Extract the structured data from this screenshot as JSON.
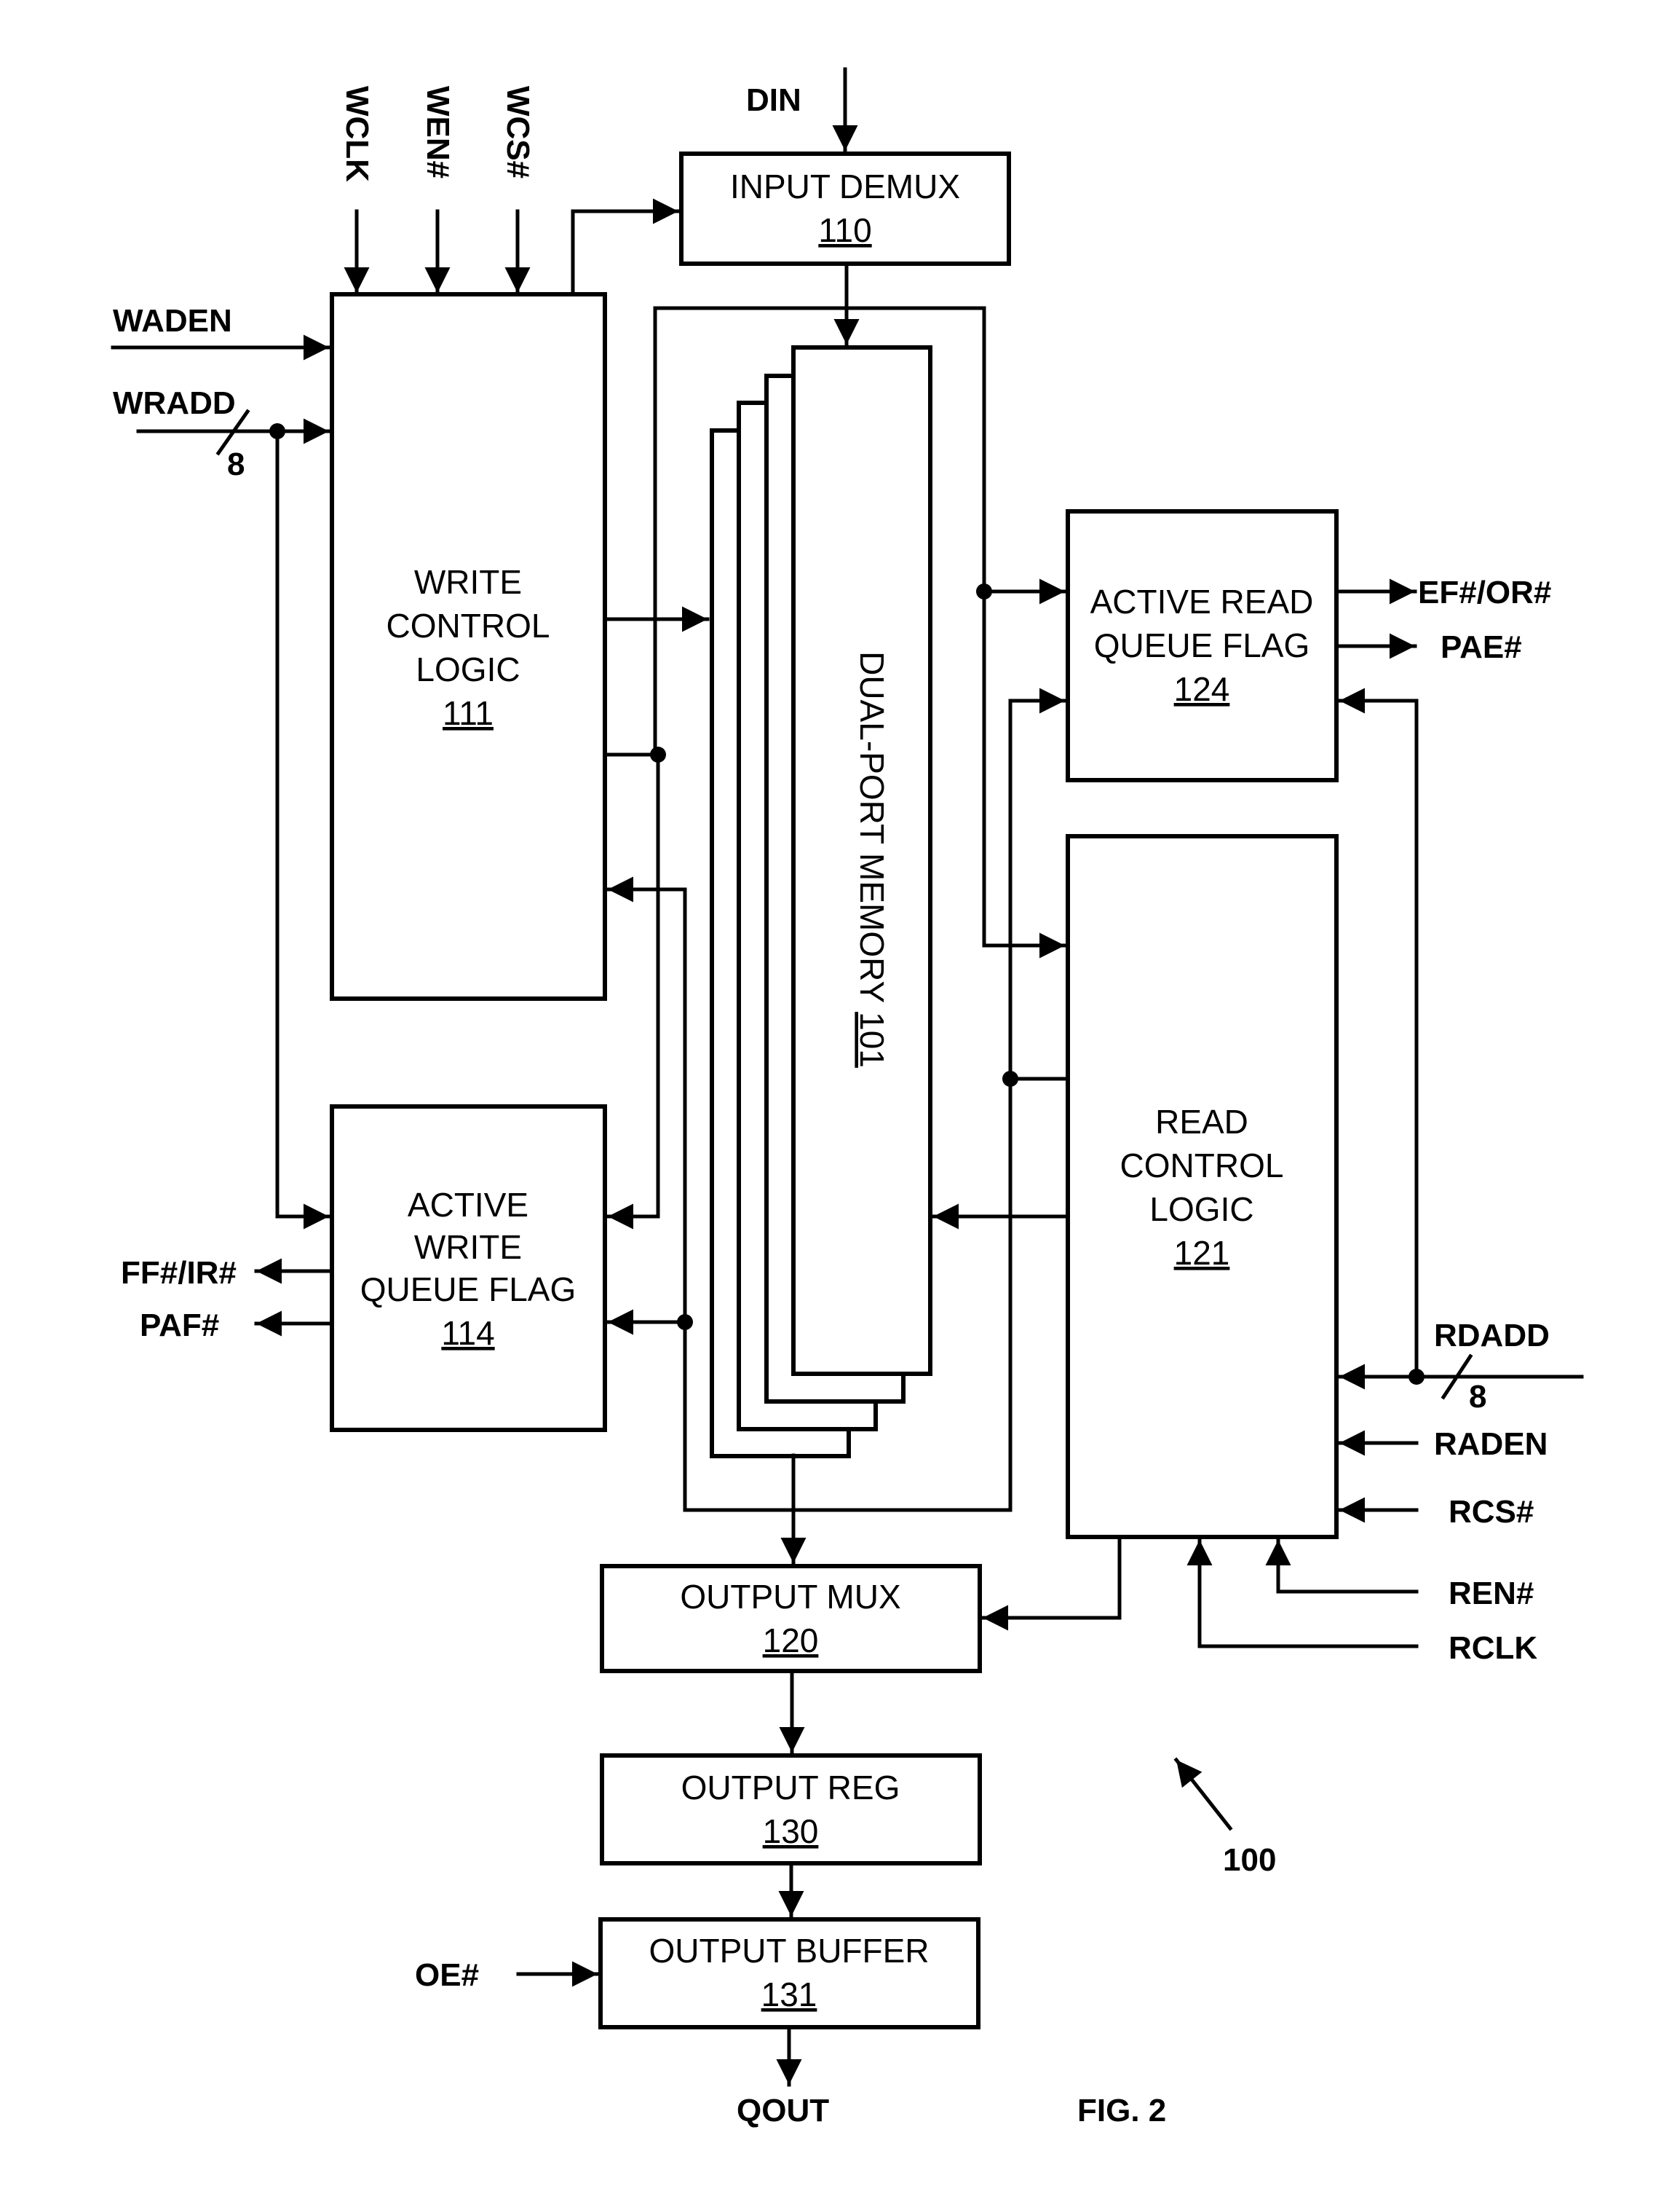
{
  "figure": {
    "label": "FIG. 2",
    "reference": "100"
  },
  "blocks": {
    "input_demux": {
      "name": "INPUT DEMUX",
      "ref": "110"
    },
    "write_control": {
      "lines": [
        "WRITE",
        "CONTROL",
        "LOGIC"
      ],
      "ref": "111"
    },
    "write_flag": {
      "lines": [
        "ACTIVE",
        "WRITE",
        "QUEUE FLAG"
      ],
      "ref": "114"
    },
    "memory": {
      "name": "DUAL-PORT MEMORY",
      "ref": "101"
    },
    "read_flag": {
      "lines": [
        "ACTIVE READ",
        "QUEUE FLAG"
      ],
      "ref": "124"
    },
    "read_control": {
      "lines": [
        "READ",
        "CONTROL",
        "LOGIC"
      ],
      "ref": "121"
    },
    "output_mux": {
      "name": "OUTPUT MUX",
      "ref": "120"
    },
    "output_reg": {
      "name": "OUTPUT REG",
      "ref": "130"
    },
    "output_buffer": {
      "name": "OUTPUT BUFFER",
      "ref": "131"
    }
  },
  "signals": {
    "din": "DIN",
    "wclk": "WCLK",
    "wen": "WEN#",
    "wcs": "WCS#",
    "waden": "WADEN",
    "wradd": "WRADD",
    "wradd_width": "8",
    "ff_ir": "FF#/IR#",
    "paf": "PAF#",
    "ef_or": "EF#/OR#",
    "pae": "PAE#",
    "rdadd": "RDADD",
    "rdadd_width": "8",
    "raden": "RADEN",
    "rcs": "RCS#",
    "ren": "REN#",
    "rclk": "RCLK",
    "oe": "OE#",
    "qout": "QOUT"
  }
}
